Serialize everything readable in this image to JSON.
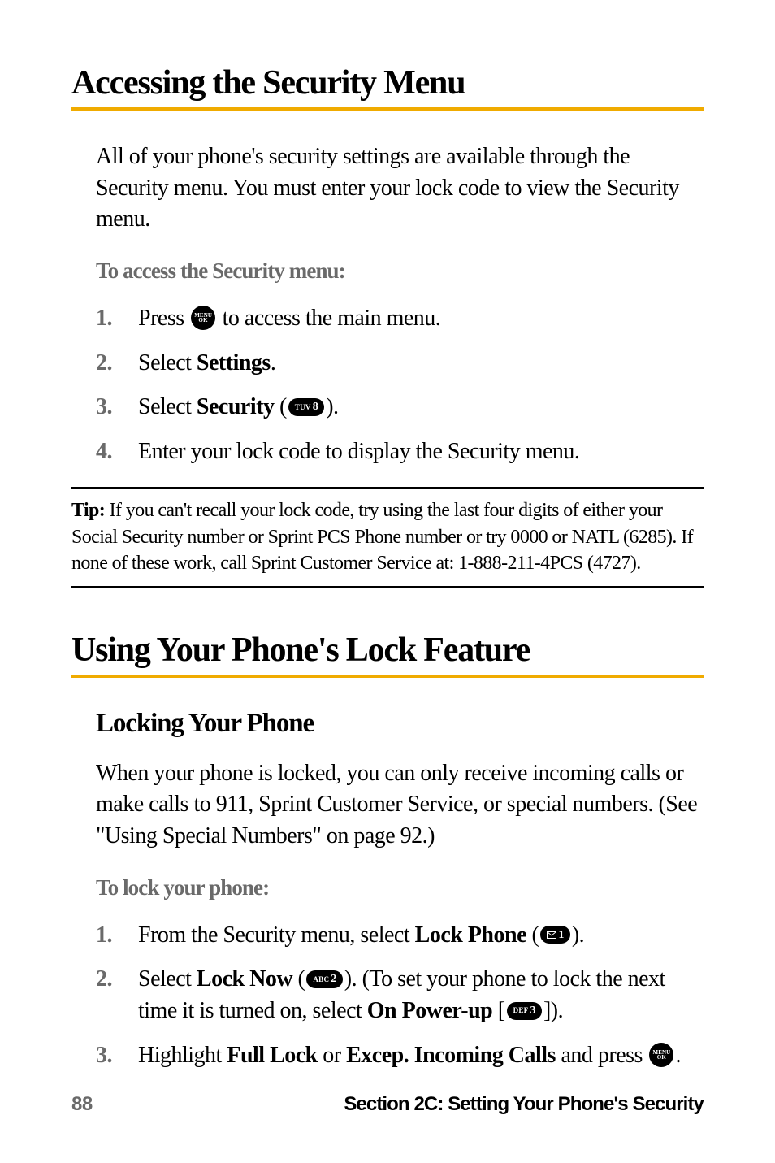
{
  "h1_1": "Accessing the Security Menu",
  "p1_intro": "All of your phone's security settings are available through the Security menu. You must enter your lock code to view the Security menu.",
  "p1_subhead": "To access the Security menu:",
  "p1_steps": {
    "s1": {
      "num": "1.",
      "pre": "Press ",
      "post": " to access the main menu."
    },
    "s2": {
      "num": "2.",
      "pre": "Select ",
      "b": "Settings",
      "post": "."
    },
    "s3": {
      "num": "3.",
      "pre": "Select ",
      "b": "Security",
      "par_open": " (",
      "key_letters": "TUV",
      "key_num": "8",
      "par_close": ")."
    },
    "s4": {
      "num": "4.",
      "text": "Enter your lock code to display the Security menu."
    }
  },
  "tip": {
    "label": "Tip:",
    "body": " If you can't recall your lock code, try using the last four digits of either your Social Security number or Sprint PCS Phone number or try 0000 or NATL (6285). If none of these work, call Sprint Customer Service at: 1-888-211-4PCS (4727)."
  },
  "h1_2": "Using Your Phone's Lock Feature",
  "h3_1": "Locking Your Phone",
  "p2_body": "When your phone is locked, you can only receive incoming calls or make calls to 911, Sprint Customer Service, or special numbers. (See \"Using Special Numbers\" on page 92.)",
  "p2_subhead": "To lock your phone:",
  "p2_steps": {
    "s1": {
      "num": "1.",
      "pre": "From the Security menu, select ",
      "b": "Lock Phone",
      "par_open": " (",
      "key_num": "1",
      "par_close": ")."
    },
    "s2": {
      "num": "2.",
      "pre": "Select ",
      "b1": "Lock Now",
      "par1_open": " (",
      "k1_letters": "ABC",
      "k1_num": "2",
      "par1_close": "). ",
      "mid": "(To set your phone to lock the next time it is turned on, select ",
      "b2": "On Power-up",
      "br_open": " [",
      "k2_letters": "DEF",
      "k2_num": "3",
      "br_close": "])."
    },
    "s3": {
      "num": "3.",
      "pre": "Highlight ",
      "b1": "Full Lock",
      "or": " or ",
      "b2": "Excep. Incoming Calls",
      "and": " and press ",
      "post": "."
    }
  },
  "menu_key": {
    "top": "MENU",
    "bot": "OK"
  },
  "footer": {
    "page": "88",
    "section": "Section 2C: Setting Your Phone's Security"
  }
}
